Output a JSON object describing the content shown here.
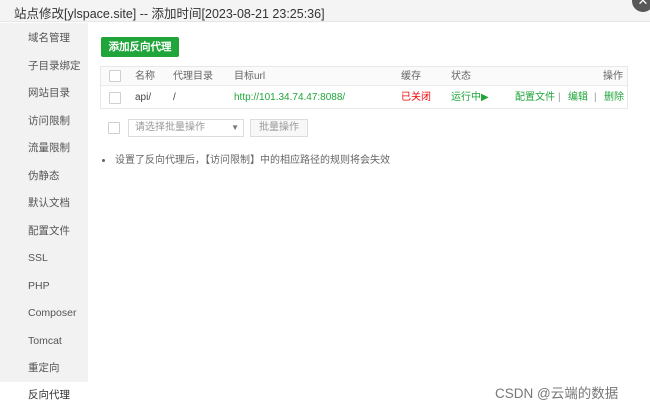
{
  "window": {
    "title": "站点修改[ylspace.site] -- 添加时间[2023-08-21 23:25:36]",
    "close_glyph": "✕"
  },
  "sidebar": {
    "items": [
      {
        "label": "域名管理"
      },
      {
        "label": "子目录绑定"
      },
      {
        "label": "网站目录"
      },
      {
        "label": "访问限制"
      },
      {
        "label": "流量限制"
      },
      {
        "label": "伪静态"
      },
      {
        "label": "默认文档"
      },
      {
        "label": "配置文件"
      },
      {
        "label": "SSL"
      },
      {
        "label": "PHP"
      },
      {
        "label": "Composer"
      },
      {
        "label": "Tomcat"
      },
      {
        "label": "重定向"
      },
      {
        "label": "反向代理",
        "active": true
      }
    ]
  },
  "main": {
    "add_button": "添加反向代理",
    "table": {
      "headers": {
        "name": "名称",
        "proxy_dir": "代理目录",
        "target_url": "目标url",
        "cache": "缓存",
        "status": "状态",
        "actions": "操作"
      },
      "rows": [
        {
          "name": "api/",
          "proxy_dir": "/",
          "target_url": "http://101.34.74.47:8088/",
          "cache": "已关闭",
          "status": "运行中▶",
          "action_config": "配置文件",
          "action_edit": "编辑",
          "action_delete": "删除",
          "separator": "|"
        }
      ]
    },
    "batch": {
      "select_placeholder": "请选择批量操作",
      "select_caret": "▼",
      "batch_button": "批量操作"
    },
    "note": "设置了反向代理后，【访问限制】中的相应路径的规则将会失效"
  },
  "watermark": "CSDN @云端的数据",
  "colors": {
    "accent_green": "#20a53a",
    "status_red": "#ef0808",
    "sidebar_bg": "#f2f2f2"
  }
}
